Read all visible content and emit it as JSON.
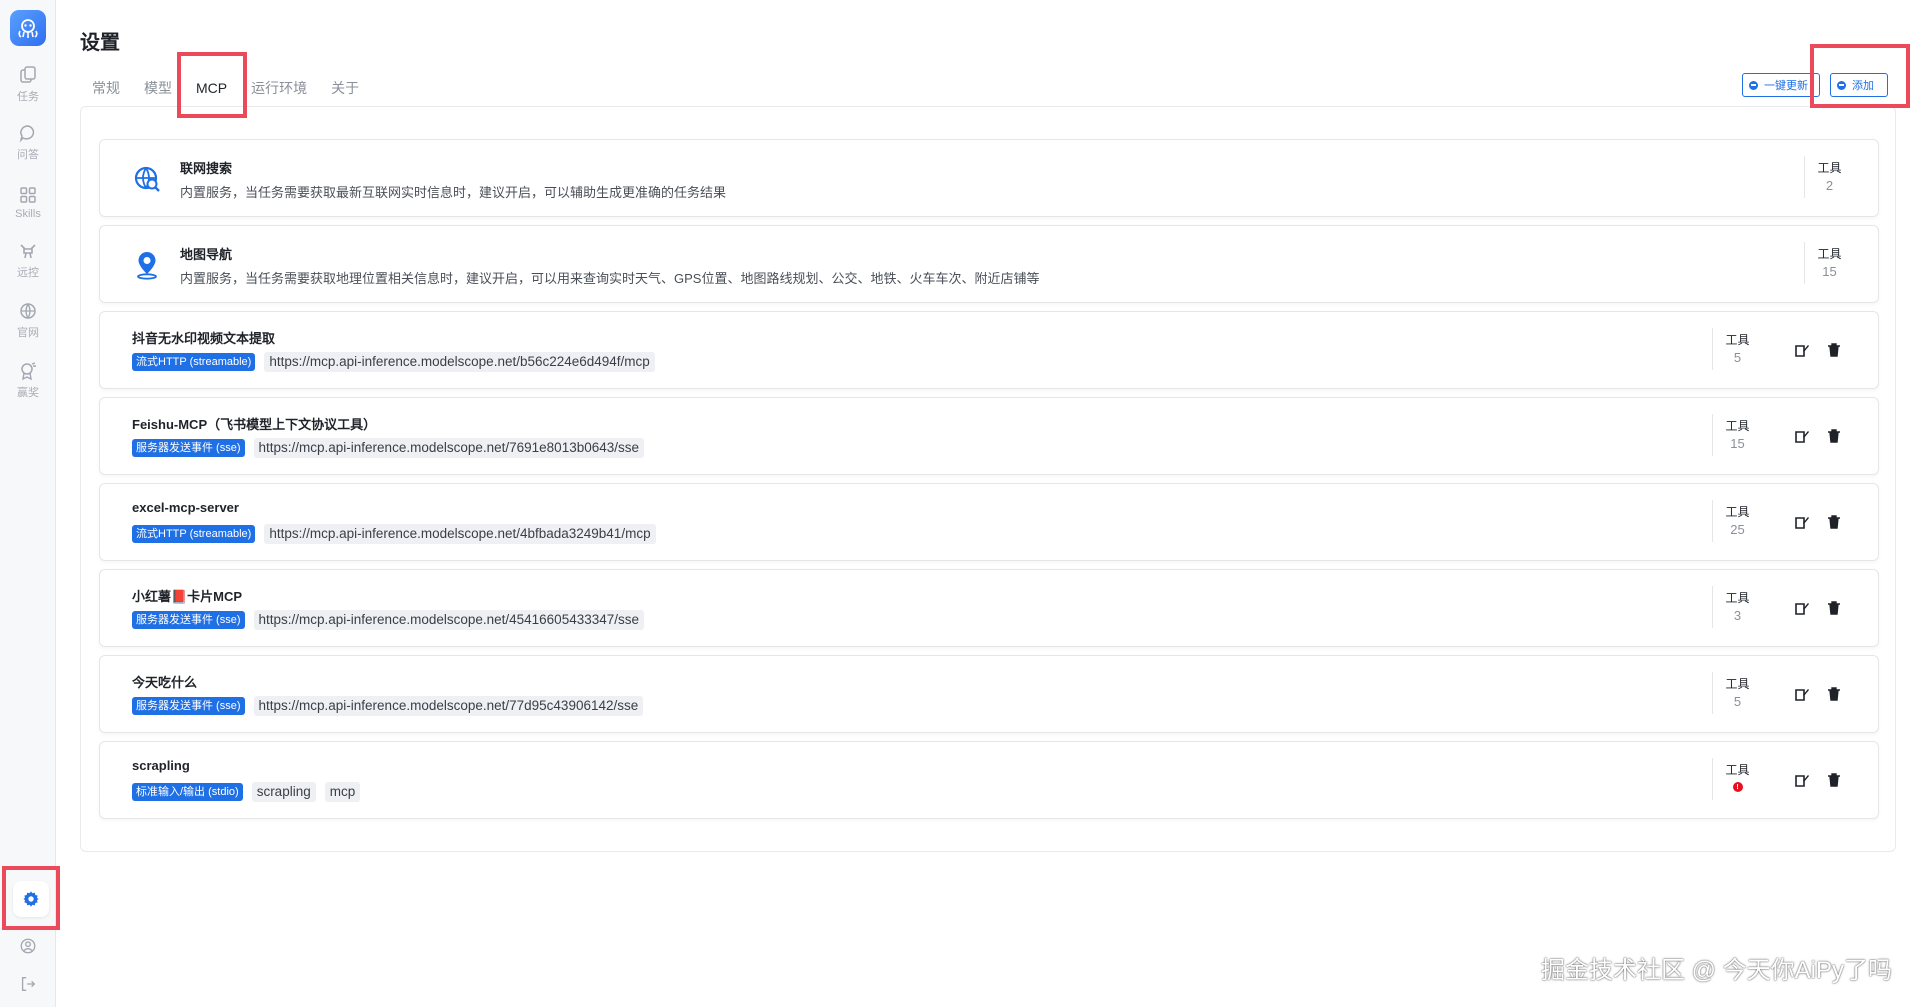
{
  "page": {
    "title": "设置"
  },
  "tabs": [
    {
      "label": "常规"
    },
    {
      "label": "模型"
    },
    {
      "label": "MCP"
    },
    {
      "label": "运行环境"
    },
    {
      "label": "关于"
    }
  ],
  "active_tab": "MCP",
  "sidebar": {
    "items": [
      {
        "label": "任务",
        "icon": "tasks-icon"
      },
      {
        "label": "问答",
        "icon": "chat-icon"
      },
      {
        "label": "Skills",
        "icon": "skills-icon"
      },
      {
        "label": "远控",
        "icon": "remote-icon"
      },
      {
        "label": "官网",
        "icon": "globe-icon"
      },
      {
        "label": "赢奖",
        "icon": "prize-icon"
      }
    ]
  },
  "actions": {
    "update_all_label": "一键更新",
    "add_label": "添加"
  },
  "tools_label": "工具",
  "servers": [
    {
      "name": "联网搜索",
      "builtin": true,
      "icon": "web-search-icon",
      "description": "内置服务，当任务需要获取最新互联网实时信息时，建议开启，可以辅助生成更准确的任务结果",
      "tools": "2"
    },
    {
      "name": "地图导航",
      "builtin": true,
      "icon": "map-pin-icon",
      "description": "内置服务，当任务需要获取地理位置相关信息时，建议开启，可以用来查询实时天气、GPS位置、地图路线规划、公交、地铁、火车车次、附近店铺等",
      "tools": "15"
    },
    {
      "name": "抖音无水印视频文本提取",
      "transport": "流式HTTP (streamable)",
      "chips": [
        "https://mcp.api-inference.modelscope.net/b56c224e6d494f/mcp"
      ],
      "tools": "5"
    },
    {
      "name": "Feishu-MCP（飞书模型上下文协议工具）",
      "transport": "服务器发送事件 (sse)",
      "chips": [
        "https://mcp.api-inference.modelscope.net/7691e8013b0643/sse"
      ],
      "tools": "15"
    },
    {
      "name": "excel-mcp-server",
      "transport": "流式HTTP (streamable)",
      "chips": [
        "https://mcp.api-inference.modelscope.net/4bfbada3249b41/mcp"
      ],
      "tools": "25"
    },
    {
      "name": "小红薯📕卡片MCP",
      "transport": "服务器发送事件 (sse)",
      "chips": [
        "https://mcp.api-inference.modelscope.net/45416605433347/sse"
      ],
      "tools": "3"
    },
    {
      "name": "今天吃什么",
      "transport": "服务器发送事件 (sse)",
      "chips": [
        "https://mcp.api-inference.modelscope.net/77d95c43906142/sse"
      ],
      "tools": "5"
    },
    {
      "name": "scrapling",
      "transport": "标准输入/输出 (stdio)",
      "chips": [
        "scrapling",
        "mcp"
      ],
      "tools": "!",
      "tools_error": true
    }
  ],
  "watermark": "掘金技术社区 @ 今天你AiPy了吗",
  "colors": {
    "accent": "#1f6fe5",
    "highlight": "#ea4a5a",
    "error": "#e8101e"
  }
}
